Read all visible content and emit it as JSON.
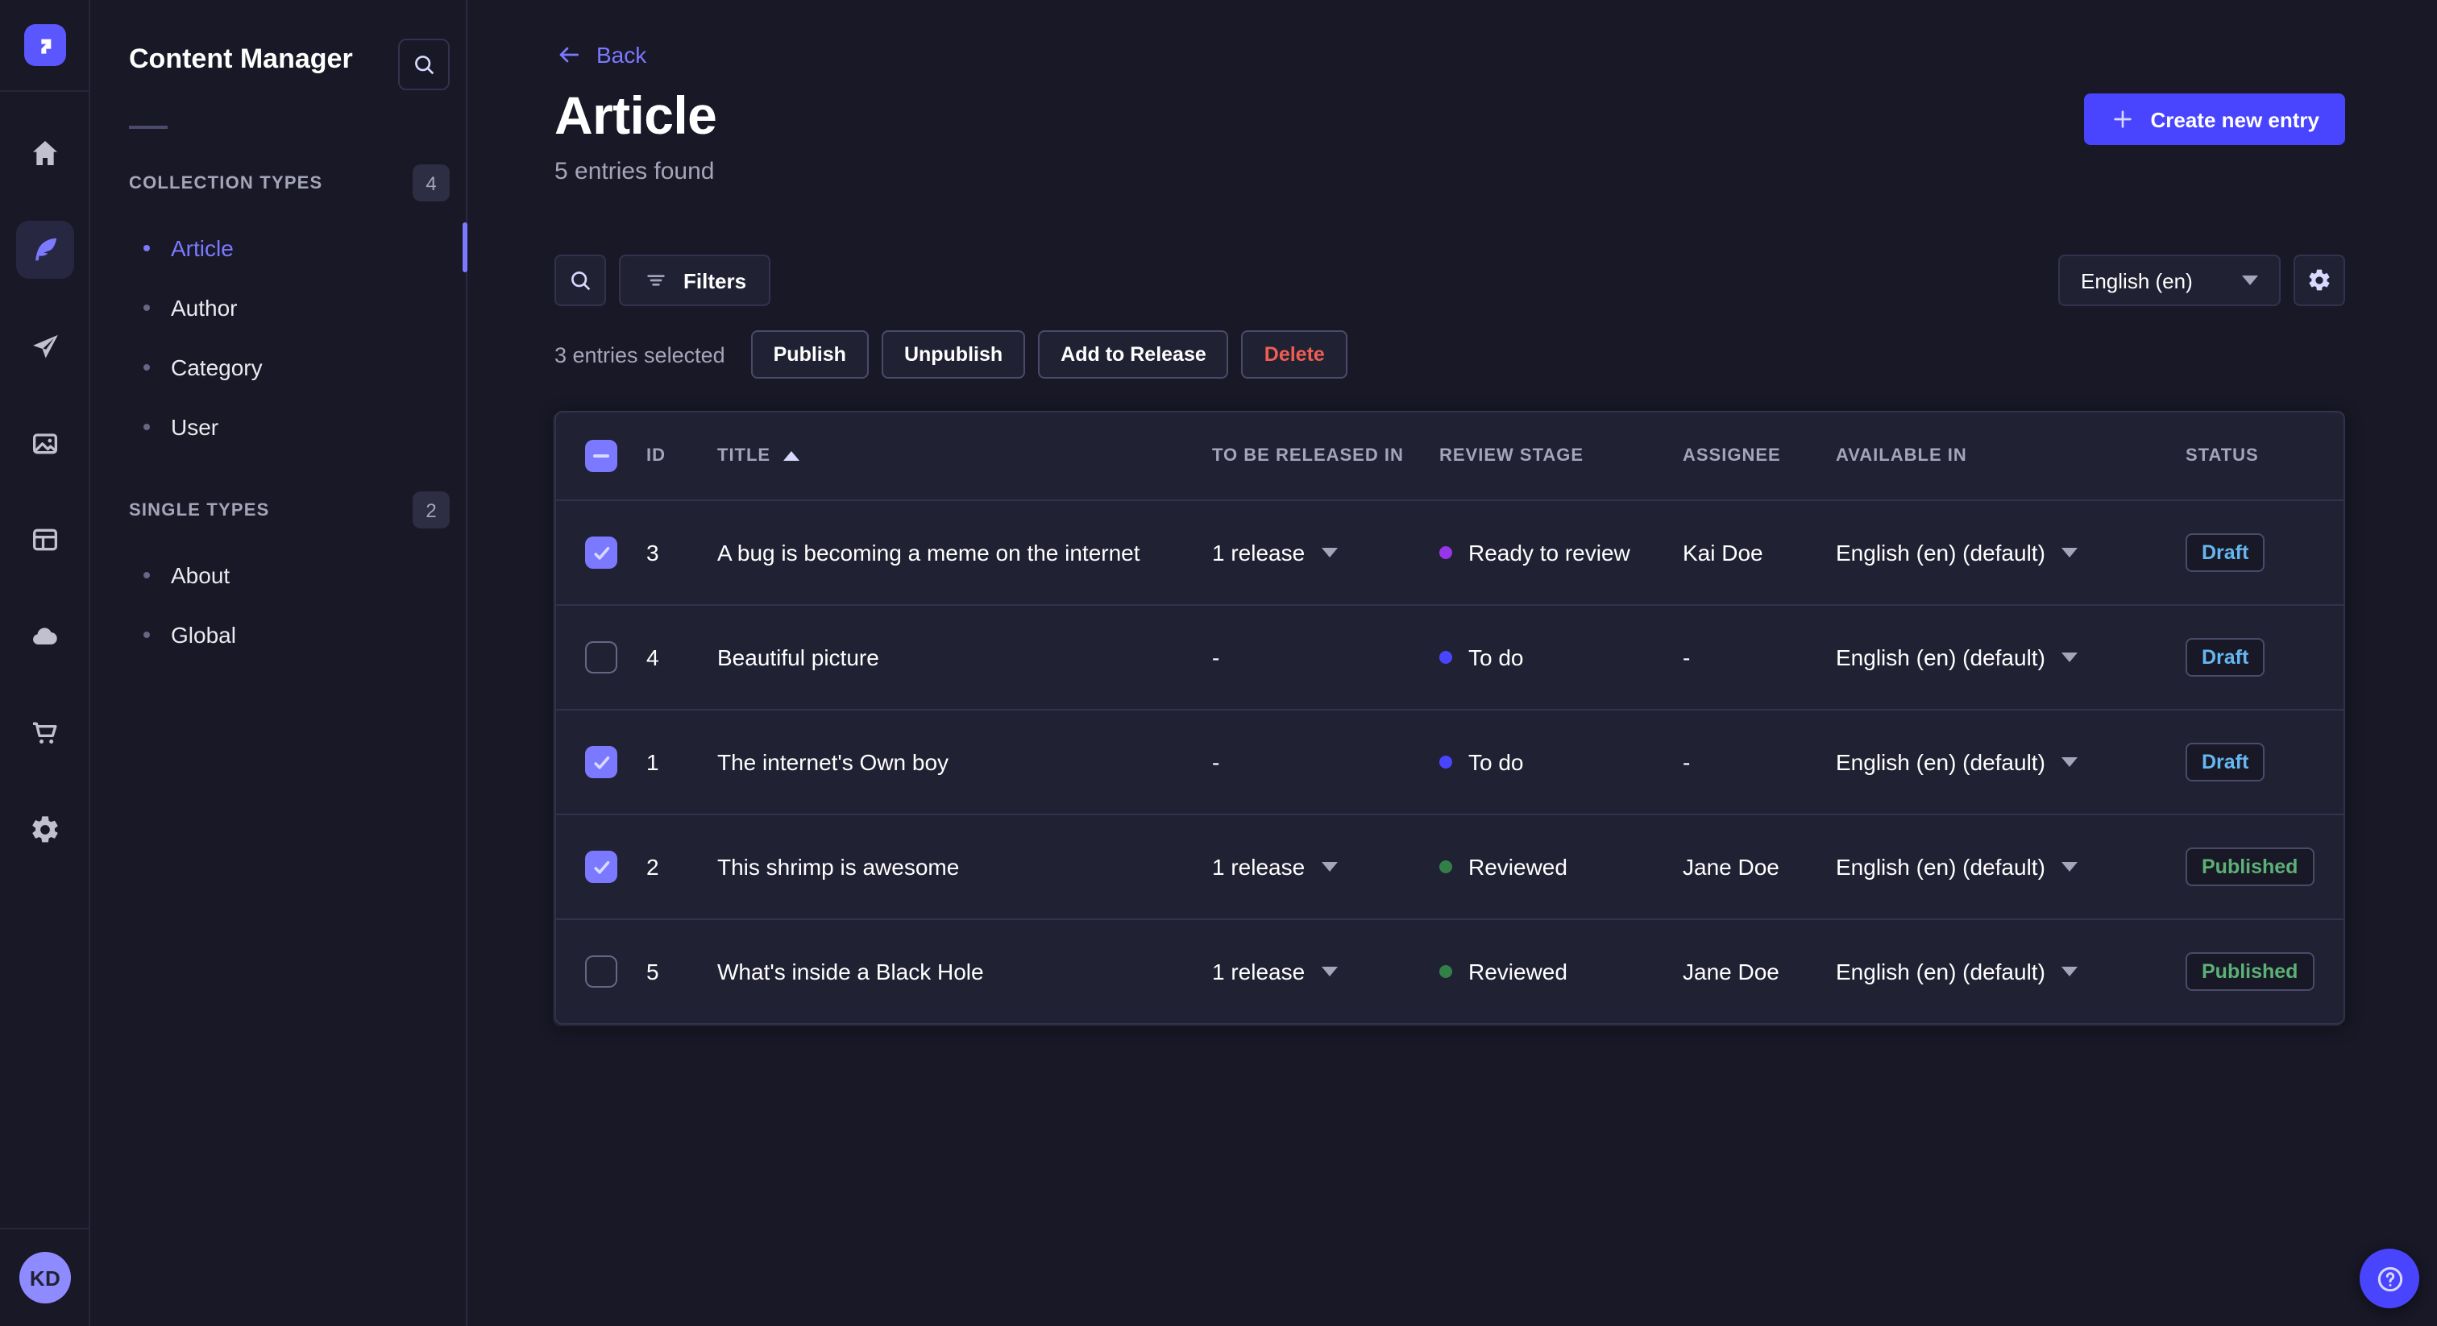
{
  "nav_rail": {
    "icons": [
      "home",
      "content-manager",
      "releases",
      "media-library",
      "content-type-builder",
      "deploy",
      "marketplace",
      "settings"
    ],
    "active": "content-manager"
  },
  "user": {
    "initials": "KD"
  },
  "sidebar": {
    "title": "Content Manager",
    "sections": [
      {
        "label": "COLLECTION TYPES",
        "badge": "4",
        "items": [
          {
            "label": "Article",
            "active": true
          },
          {
            "label": "Author",
            "active": false
          },
          {
            "label": "Category",
            "active": false
          },
          {
            "label": "User",
            "active": false
          }
        ]
      },
      {
        "label": "SINGLE TYPES",
        "badge": "2",
        "items": [
          {
            "label": "About",
            "active": false
          },
          {
            "label": "Global",
            "active": false
          }
        ]
      }
    ]
  },
  "header": {
    "back_label": "Back",
    "title": "Article",
    "subtitle": "5 entries found",
    "create_button": "Create new entry"
  },
  "toolbar": {
    "filters_label": "Filters",
    "locale_value": "English (en)"
  },
  "selection": {
    "text": "3 entries selected",
    "publish": "Publish",
    "unpublish": "Unpublish",
    "add_to_release": "Add to Release",
    "delete": "Delete"
  },
  "table": {
    "header_checkbox": "indeterminate",
    "columns": [
      "ID",
      "TITLE",
      "TO BE RELEASED IN",
      "REVIEW STAGE",
      "ASSIGNEE",
      "AVAILABLE IN",
      "STATUS"
    ],
    "sorted_column": "TITLE",
    "sort_direction": "asc",
    "rows": [
      {
        "checked": true,
        "id": "3",
        "title": "A bug is becoming a meme on the internet",
        "release": "1 release",
        "has_release": true,
        "stage": "Ready to review",
        "stage_color": "#9736e8",
        "assignee": "Kai Doe",
        "locale": "English (en) (default)",
        "status": "Draft",
        "status_color": "#66b7f1"
      },
      {
        "checked": false,
        "id": "4",
        "title": "Beautiful picture",
        "release": "-",
        "has_release": false,
        "stage": "To do",
        "stage_color": "#4945ff",
        "assignee": "-",
        "locale": "English (en) (default)",
        "status": "Draft",
        "status_color": "#66b7f1"
      },
      {
        "checked": true,
        "id": "1",
        "title": "The internet's Own boy",
        "release": "-",
        "has_release": false,
        "stage": "To do",
        "stage_color": "#4945ff",
        "assignee": "-",
        "locale": "English (en) (default)",
        "status": "Draft",
        "status_color": "#66b7f1"
      },
      {
        "checked": true,
        "id": "2",
        "title": "This shrimp is awesome",
        "release": "1 release",
        "has_release": true,
        "stage": "Reviewed",
        "stage_color": "#328048",
        "assignee": "Jane Doe",
        "locale": "English (en) (default)",
        "status": "Published",
        "status_color": "#5cb176"
      },
      {
        "checked": false,
        "id": "5",
        "title": "What's inside a Black Hole",
        "release": "1 release",
        "has_release": true,
        "stage": "Reviewed",
        "stage_color": "#328048",
        "assignee": "Jane Doe",
        "locale": "English (en) (default)",
        "status": "Published",
        "status_color": "#5cb176"
      }
    ]
  },
  "colors": {
    "accent": "#4945ff",
    "active_link": "#7b79ff",
    "draft": "#66b7f1",
    "published": "#5cb176",
    "danger": "#ee5e52",
    "background": "#181826",
    "surface": "#212134"
  }
}
